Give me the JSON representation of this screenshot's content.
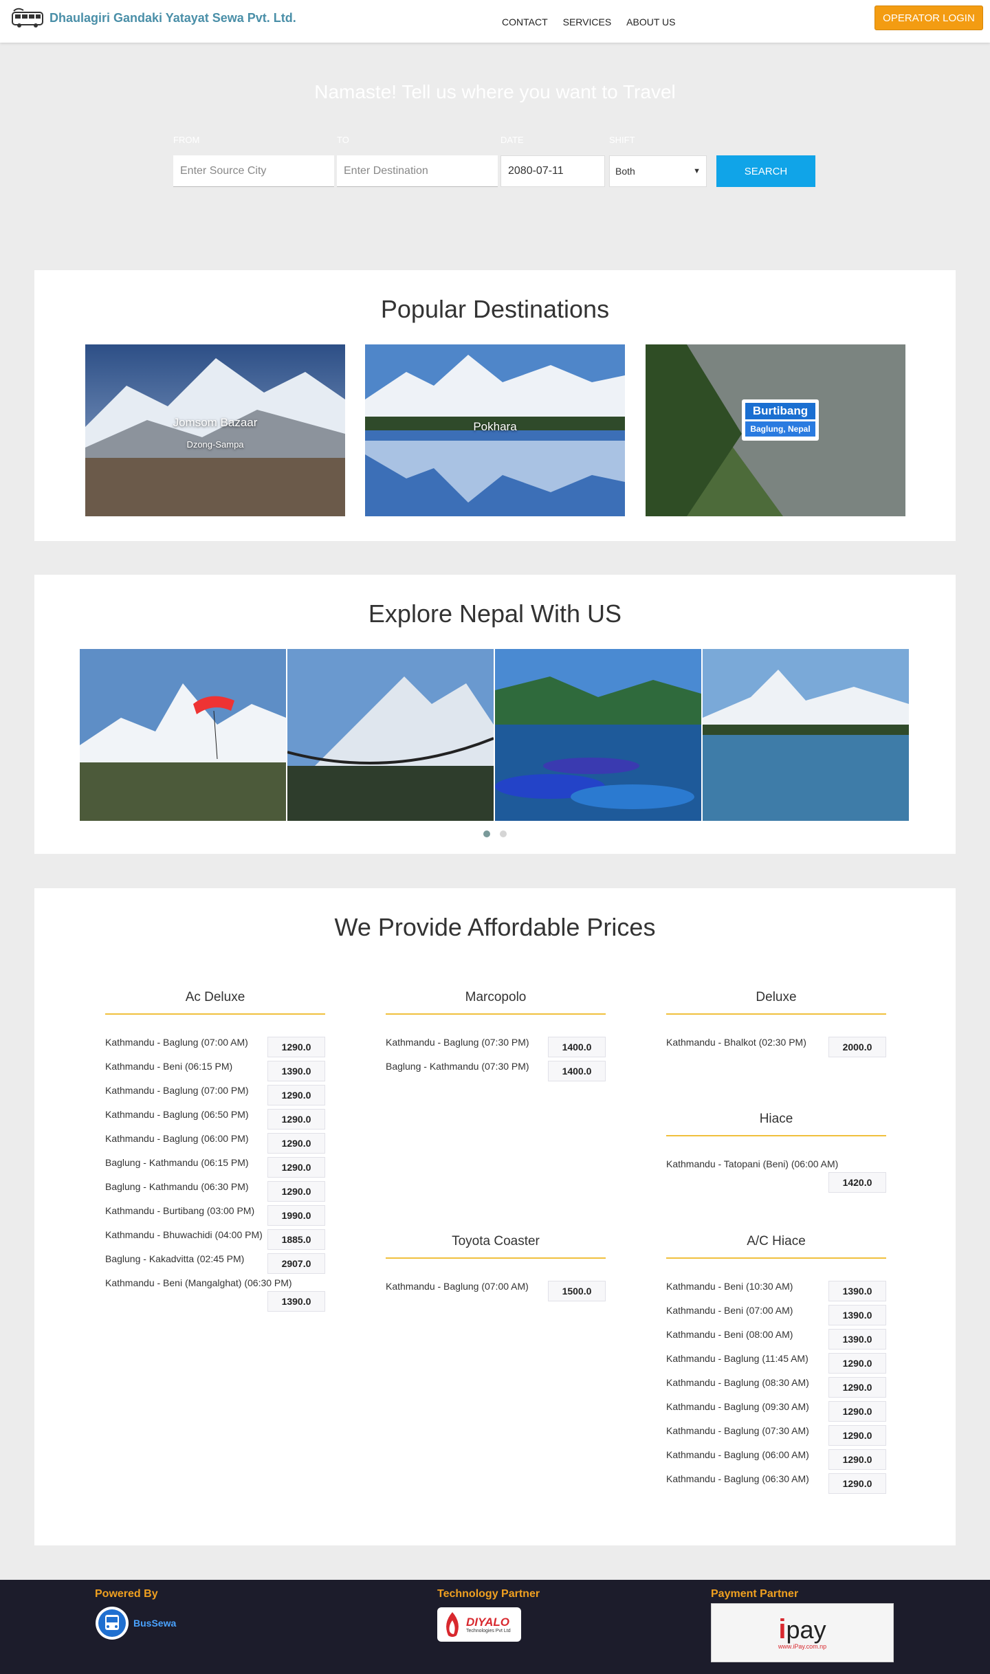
{
  "brand": {
    "name": "Dhaulagiri Gandaki Yatayat Sewa Pvt. Ltd."
  },
  "nav": {
    "items": [
      "CONTACT",
      "SERVICES",
      "ABOUT US"
    ],
    "operator_login": "OPERATOR LOGIN"
  },
  "hero": {
    "title": "Namaste! Tell us where you want to Travel"
  },
  "search": {
    "from_label": "FROM",
    "from_placeholder": "Enter Source City",
    "to_label": "TO",
    "to_placeholder": "Enter Destination",
    "date_label": "DATE",
    "date_value": "2080-07-11",
    "shift_label": "SHIFT",
    "shift_value": "Both",
    "button": "SEARCH"
  },
  "popular": {
    "title": "Popular Destinations",
    "items": [
      {
        "name": "Jomsom Bazaar",
        "sub": "Dzong-Sampa"
      },
      {
        "name": "Pokhara",
        "sub": ""
      },
      {
        "name": "Burtibang",
        "sub": "Baglung, Nepal"
      }
    ]
  },
  "explore": {
    "title": "Explore Nepal With US"
  },
  "prices": {
    "title": "We Provide Affordable Prices",
    "ac_deluxe": {
      "title": "Ac Deluxe",
      "rows": [
        [
          "Kathmandu - Baglung (07:00 AM)",
          "1290.0"
        ],
        [
          "Kathmandu - Beni (06:15 PM)",
          "1390.0"
        ],
        [
          "Kathmandu - Baglung (07:00 PM)",
          "1290.0"
        ],
        [
          "Kathmandu - Baglung (06:50 PM)",
          "1290.0"
        ],
        [
          "Kathmandu - Baglung (06:00 PM)",
          "1290.0"
        ],
        [
          "Baglung - Kathmandu (06:15 PM)",
          "1290.0"
        ],
        [
          "Baglung - Kathmandu (06:30 PM)",
          "1290.0"
        ],
        [
          "Kathmandu - Burtibang (03:00 PM)",
          "1990.0"
        ],
        [
          "Kathmandu - Bhuwachidi (04:00 PM)",
          "1885.0"
        ],
        [
          "Baglung - Kakadvitta (02:45 PM)",
          "2907.0"
        ],
        [
          "Kathmandu - Beni (Mangalghat) (06:30 PM)",
          "1390.0"
        ]
      ]
    },
    "marcopolo": {
      "title": "Marcopolo",
      "rows": [
        [
          "Kathmandu - Baglung (07:30 PM)",
          "1400.0"
        ],
        [
          "Baglung - Kathmandu (07:30 PM)",
          "1400.0"
        ]
      ]
    },
    "deluxe": {
      "title": "Deluxe",
      "rows": [
        [
          "Kathmandu - Bhalkot (02:30 PM)",
          "2000.0"
        ]
      ]
    },
    "hiace": {
      "title": "Hiace",
      "rows": [
        [
          "Kathmandu - Tatopani (Beni) (06:00 AM)",
          "1420.0"
        ]
      ]
    },
    "toyota_coaster": {
      "title": "Toyota Coaster",
      "rows": [
        [
          "Kathmandu - Baglung (07:00 AM)",
          "1500.0"
        ]
      ]
    },
    "ac_hiace": {
      "title": "A/C Hiace",
      "rows": [
        [
          "Kathmandu - Beni (10:30 AM)",
          "1390.0"
        ],
        [
          "Kathmandu - Beni (07:00 AM)",
          "1390.0"
        ],
        [
          "Kathmandu - Beni (08:00 AM)",
          "1390.0"
        ],
        [
          "Kathmandu - Baglung (11:45 AM)",
          "1290.0"
        ],
        [
          "Kathmandu - Baglung (08:30 AM)",
          "1290.0"
        ],
        [
          "Kathmandu - Baglung (09:30 AM)",
          "1290.0"
        ],
        [
          "Kathmandu - Baglung (07:30 AM)",
          "1290.0"
        ],
        [
          "Kathmandu - Baglung (06:00 AM)",
          "1290.0"
        ],
        [
          "Kathmandu - Baglung (06:30 AM)",
          "1290.0"
        ]
      ]
    }
  },
  "footer": {
    "powered_by": "Powered By",
    "powered_name": "BusSewa",
    "tech_partner": "Technology Partner",
    "tech_name": "DIYALO",
    "tech_sub": "Technologies Pvt Ltd",
    "payment_partner": "Payment Partner",
    "payment_name": "pay",
    "payment_url": "www.iPay.com.np"
  },
  "colors": {
    "accent": "#f39c12",
    "search": "#10a4e8",
    "brand": "#4a8fa8",
    "footer_bg": "#1c1c2b"
  }
}
